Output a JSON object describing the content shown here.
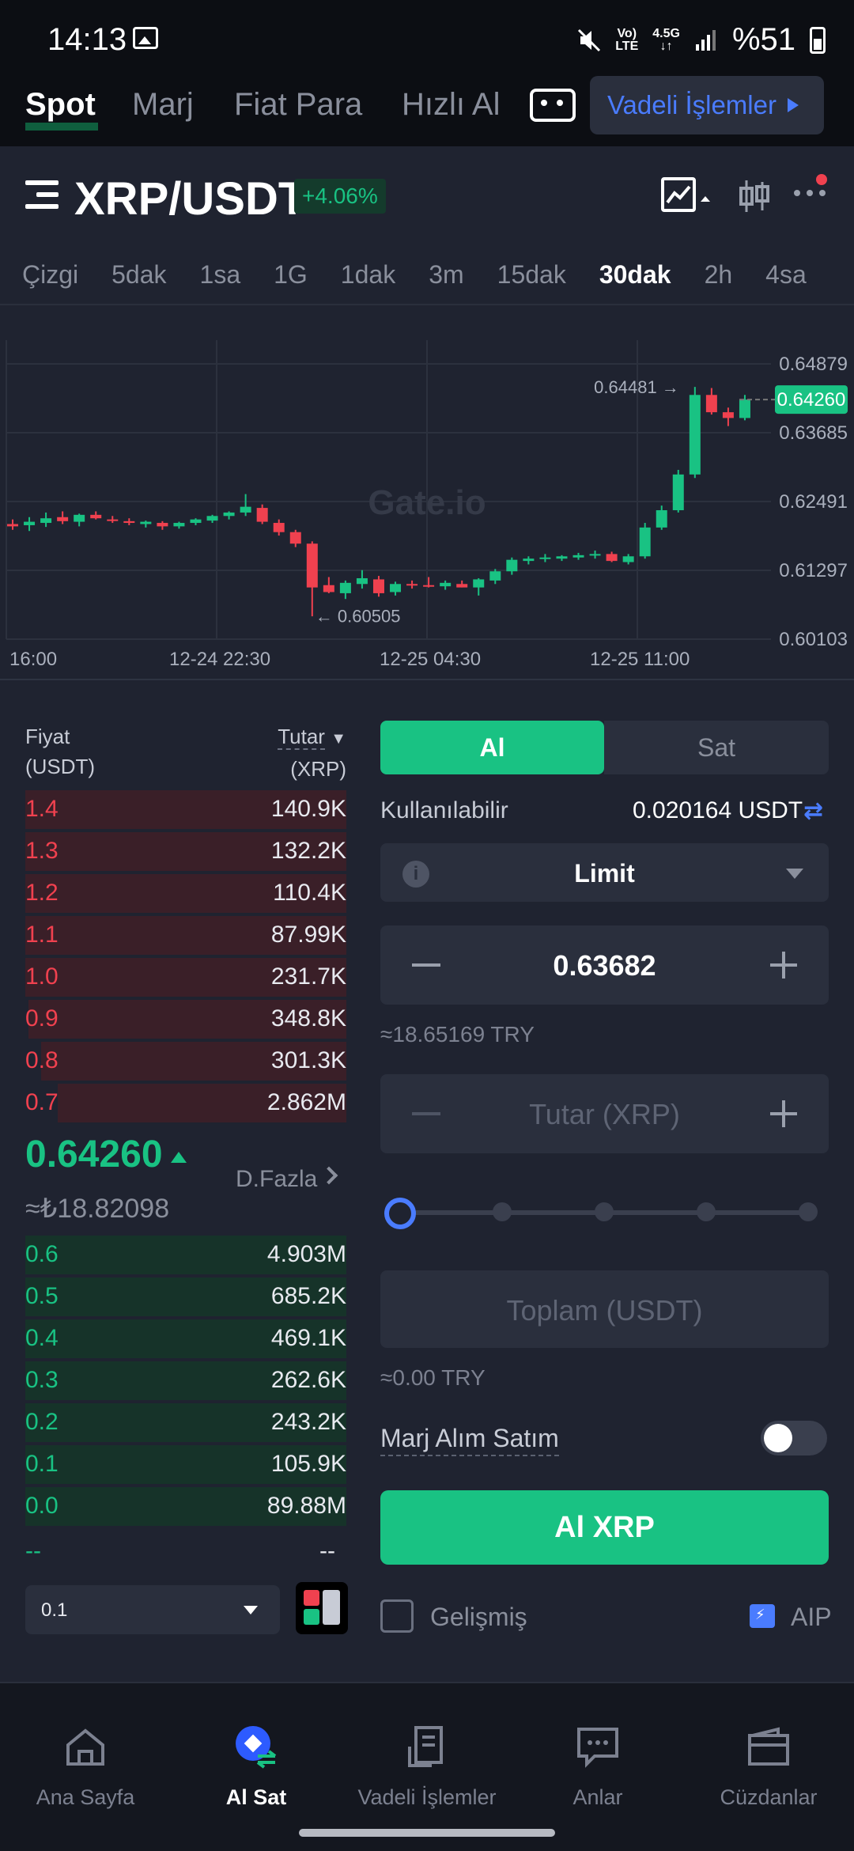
{
  "status_bar": {
    "time": "14:13",
    "network_top": "Vo)",
    "network_bottom": "LTE",
    "data_top": "4.5G",
    "battery": "%51"
  },
  "top_nav": {
    "tabs": [
      "Spot",
      "Marj",
      "Fiat Para",
      "Hızlı Al"
    ],
    "active": "Spot",
    "futures_button": "Vadeli İşlemler"
  },
  "pair": {
    "symbol": "XRP/USDT",
    "change": "+4.06%"
  },
  "timeframes": [
    "Çizgi",
    "5dak",
    "1sa",
    "1G",
    "1dak",
    "3m",
    "15dak",
    "30dak",
    "2h",
    "4sa"
  ],
  "active_timeframe": "30dak",
  "chart_data": {
    "type": "candlestick",
    "watermark": "Gate.io",
    "y_ticks": [
      "0.64879",
      "0.63685",
      "0.62491",
      "0.61297",
      "0.60103"
    ],
    "y_range": [
      0.60103,
      0.64879
    ],
    "x_ticks": [
      "16:00",
      "12-24 22:30",
      "12-25 04:30",
      "12-25 11:00"
    ],
    "current_price": "0.64260",
    "high_marker": "0.64481",
    "low_marker": "0.60505",
    "up_color": "#19c283",
    "down_color": "#f0414f",
    "candles": [
      [
        0.621,
        0.6218,
        0.62,
        0.6206
      ],
      [
        0.6208,
        0.6222,
        0.6198,
        0.6214
      ],
      [
        0.6212,
        0.623,
        0.6205,
        0.622
      ],
      [
        0.6222,
        0.6232,
        0.621,
        0.6215
      ],
      [
        0.6214,
        0.6228,
        0.6206,
        0.6226
      ],
      [
        0.6226,
        0.6232,
        0.6218,
        0.622
      ],
      [
        0.6218,
        0.6224,
        0.6212,
        0.6216
      ],
      [
        0.6215,
        0.622,
        0.6208,
        0.6212
      ],
      [
        0.621,
        0.6216,
        0.6204,
        0.6214
      ],
      [
        0.6212,
        0.6215,
        0.62,
        0.6206
      ],
      [
        0.6206,
        0.6214,
        0.6202,
        0.6212
      ],
      [
        0.6212,
        0.622,
        0.6208,
        0.6218
      ],
      [
        0.6216,
        0.6226,
        0.6212,
        0.6224
      ],
      [
        0.6224,
        0.6232,
        0.6218,
        0.623
      ],
      [
        0.623,
        0.6262,
        0.6224,
        0.624
      ],
      [
        0.6238,
        0.6244,
        0.621,
        0.6214
      ],
      [
        0.6212,
        0.6218,
        0.619,
        0.6196
      ],
      [
        0.6196,
        0.62,
        0.617,
        0.6176
      ],
      [
        0.6176,
        0.618,
        0.605,
        0.61
      ],
      [
        0.6104,
        0.6118,
        0.609,
        0.6092
      ],
      [
        0.609,
        0.6112,
        0.608,
        0.6108
      ],
      [
        0.6106,
        0.613,
        0.6098,
        0.6116
      ],
      [
        0.6114,
        0.612,
        0.6084,
        0.609
      ],
      [
        0.6092,
        0.611,
        0.6086,
        0.6106
      ],
      [
        0.6106,
        0.6112,
        0.6098,
        0.6104
      ],
      [
        0.6104,
        0.6118,
        0.61,
        0.6102
      ],
      [
        0.6102,
        0.6112,
        0.6096,
        0.6108
      ],
      [
        0.6106,
        0.6112,
        0.61,
        0.61
      ],
      [
        0.61,
        0.6116,
        0.6086,
        0.6114
      ],
      [
        0.6112,
        0.6132,
        0.6106,
        0.6128
      ],
      [
        0.6128,
        0.6152,
        0.6122,
        0.6148
      ],
      [
        0.6146,
        0.6154,
        0.614,
        0.615
      ],
      [
        0.615,
        0.6158,
        0.6144,
        0.6152
      ],
      [
        0.615,
        0.6156,
        0.6146,
        0.6154
      ],
      [
        0.6152,
        0.616,
        0.6148,
        0.6156
      ],
      [
        0.6156,
        0.6164,
        0.615,
        0.6158
      ],
      [
        0.6158,
        0.6162,
        0.6144,
        0.6146
      ],
      [
        0.6144,
        0.6158,
        0.614,
        0.6154
      ],
      [
        0.6154,
        0.6212,
        0.615,
        0.6204
      ],
      [
        0.6204,
        0.6242,
        0.62,
        0.6234
      ],
      [
        0.6234,
        0.6304,
        0.623,
        0.6296
      ],
      [
        0.6296,
        0.6448,
        0.629,
        0.6434
      ],
      [
        0.6434,
        0.6446,
        0.64,
        0.6404
      ],
      [
        0.6404,
        0.6412,
        0.638,
        0.6394
      ],
      [
        0.6394,
        0.6434,
        0.639,
        0.6426
      ]
    ]
  },
  "orderbook": {
    "price_header": "Fiyat",
    "price_unit": "(USDT)",
    "amount_header": "Tutar",
    "amount_unit": "(XRP)",
    "asks": [
      {
        "price": "1.4",
        "amount": "140.9K",
        "depth": 1.0
      },
      {
        "price": "1.3",
        "amount": "132.2K",
        "depth": 1.0
      },
      {
        "price": "1.2",
        "amount": "110.4K",
        "depth": 1.0
      },
      {
        "price": "1.1",
        "amount": "87.99K",
        "depth": 1.0
      },
      {
        "price": "1.0",
        "amount": "231.7K",
        "depth": 1.0
      },
      {
        "price": "0.9",
        "amount": "348.8K",
        "depth": 0.99
      },
      {
        "price": "0.8",
        "amount": "301.3K",
        "depth": 0.95
      },
      {
        "price": "0.7",
        "amount": "2.862M",
        "depth": 0.9
      }
    ],
    "last_price": "0.64260",
    "last_price_fiat": "≈₺18.82098",
    "depth_link": "D.Fazla",
    "bids": [
      {
        "price": "0.6",
        "amount": "4.903M",
        "depth": 1.0
      },
      {
        "price": "0.5",
        "amount": "685.2K",
        "depth": 1.0
      },
      {
        "price": "0.4",
        "amount": "469.1K",
        "depth": 1.0
      },
      {
        "price": "0.3",
        "amount": "262.6K",
        "depth": 1.0
      },
      {
        "price": "0.2",
        "amount": "243.2K",
        "depth": 1.0
      },
      {
        "price": "0.1",
        "amount": "105.9K",
        "depth": 1.0
      },
      {
        "price": "0.0",
        "amount": "89.88M",
        "depth": 1.0
      }
    ],
    "empty_left": "--",
    "empty_right": "--",
    "precision": "0.1"
  },
  "trade": {
    "buy_tab": "Al",
    "sell_tab": "Sat",
    "available_label": "Kullanılabilir",
    "available_value": "0.020164 USDT",
    "order_type": "Limit",
    "price_value": "0.63682",
    "price_fiat": "≈18.65169 TRY",
    "amount_placeholder": "Tutar (XRP)",
    "total_placeholder": "Toplam (USDT)",
    "total_fiat": "≈0.00 TRY",
    "slider_position": 0,
    "margin_label": "Marj Alım Satım",
    "margin_enabled": false,
    "buy_button": "Al XRP",
    "advanced_label": "Gelişmiş",
    "aip_label": "AIP"
  },
  "bottom_nav": {
    "items": [
      {
        "label": "Ana Sayfa",
        "icon": "home-icon"
      },
      {
        "label": "Al Sat",
        "icon": "trade-icon"
      },
      {
        "label": "Vadeli İşlemler",
        "icon": "futures-icon"
      },
      {
        "label": "Anlar",
        "icon": "moments-icon"
      },
      {
        "label": "Cüzdanlar",
        "icon": "wallet-icon"
      }
    ],
    "active": "Al Sat"
  },
  "colors": {
    "green": "#19c283",
    "red": "#f0414f",
    "blue": "#4a7cff",
    "background": "#1f2330"
  }
}
